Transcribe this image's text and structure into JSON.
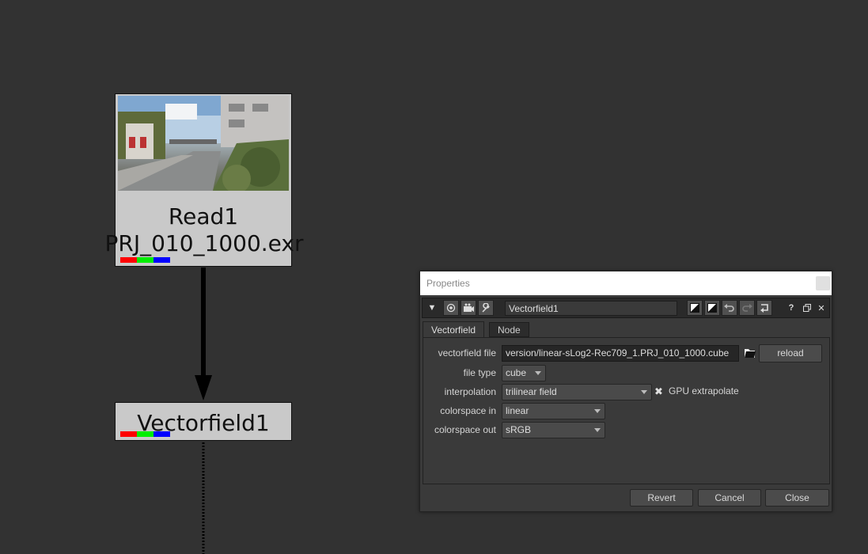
{
  "graph": {
    "read_node": {
      "name": "Read1",
      "file": "PRJ_010_1000.exr"
    },
    "vectorfield_node": {
      "name": "Vectorfield1"
    }
  },
  "properties": {
    "title": "Properties",
    "node_name": "Vectorfield1",
    "toolbar": {
      "help_label": "?"
    },
    "tabs": [
      {
        "label": "Vectorfield"
      },
      {
        "label": "Node"
      }
    ],
    "fields": {
      "vectorfield_file": {
        "label": "vectorfield file",
        "value": "version/linear-sLog2-Rec709_1.PRJ_010_1000.cube"
      },
      "reload_label": "reload",
      "file_type": {
        "label": "file type",
        "value": "cube"
      },
      "interpolation": {
        "label": "interpolation",
        "value": "trilinear field"
      },
      "gpu_extrapolate": {
        "label": "GPU extrapolate",
        "checked": true
      },
      "colorspace_in": {
        "label": "colorspace in",
        "value": "linear"
      },
      "colorspace_out": {
        "label": "colorspace out",
        "value": "sRGB"
      }
    },
    "buttons": {
      "revert": "Revert",
      "cancel": "Cancel",
      "close": "Close"
    }
  },
  "colors": {
    "background": "#323232",
    "node_body": "#c9c9c9",
    "channel_red": "#ff0000",
    "channel_green": "#00ee00",
    "channel_blue": "#0000ff"
  }
}
